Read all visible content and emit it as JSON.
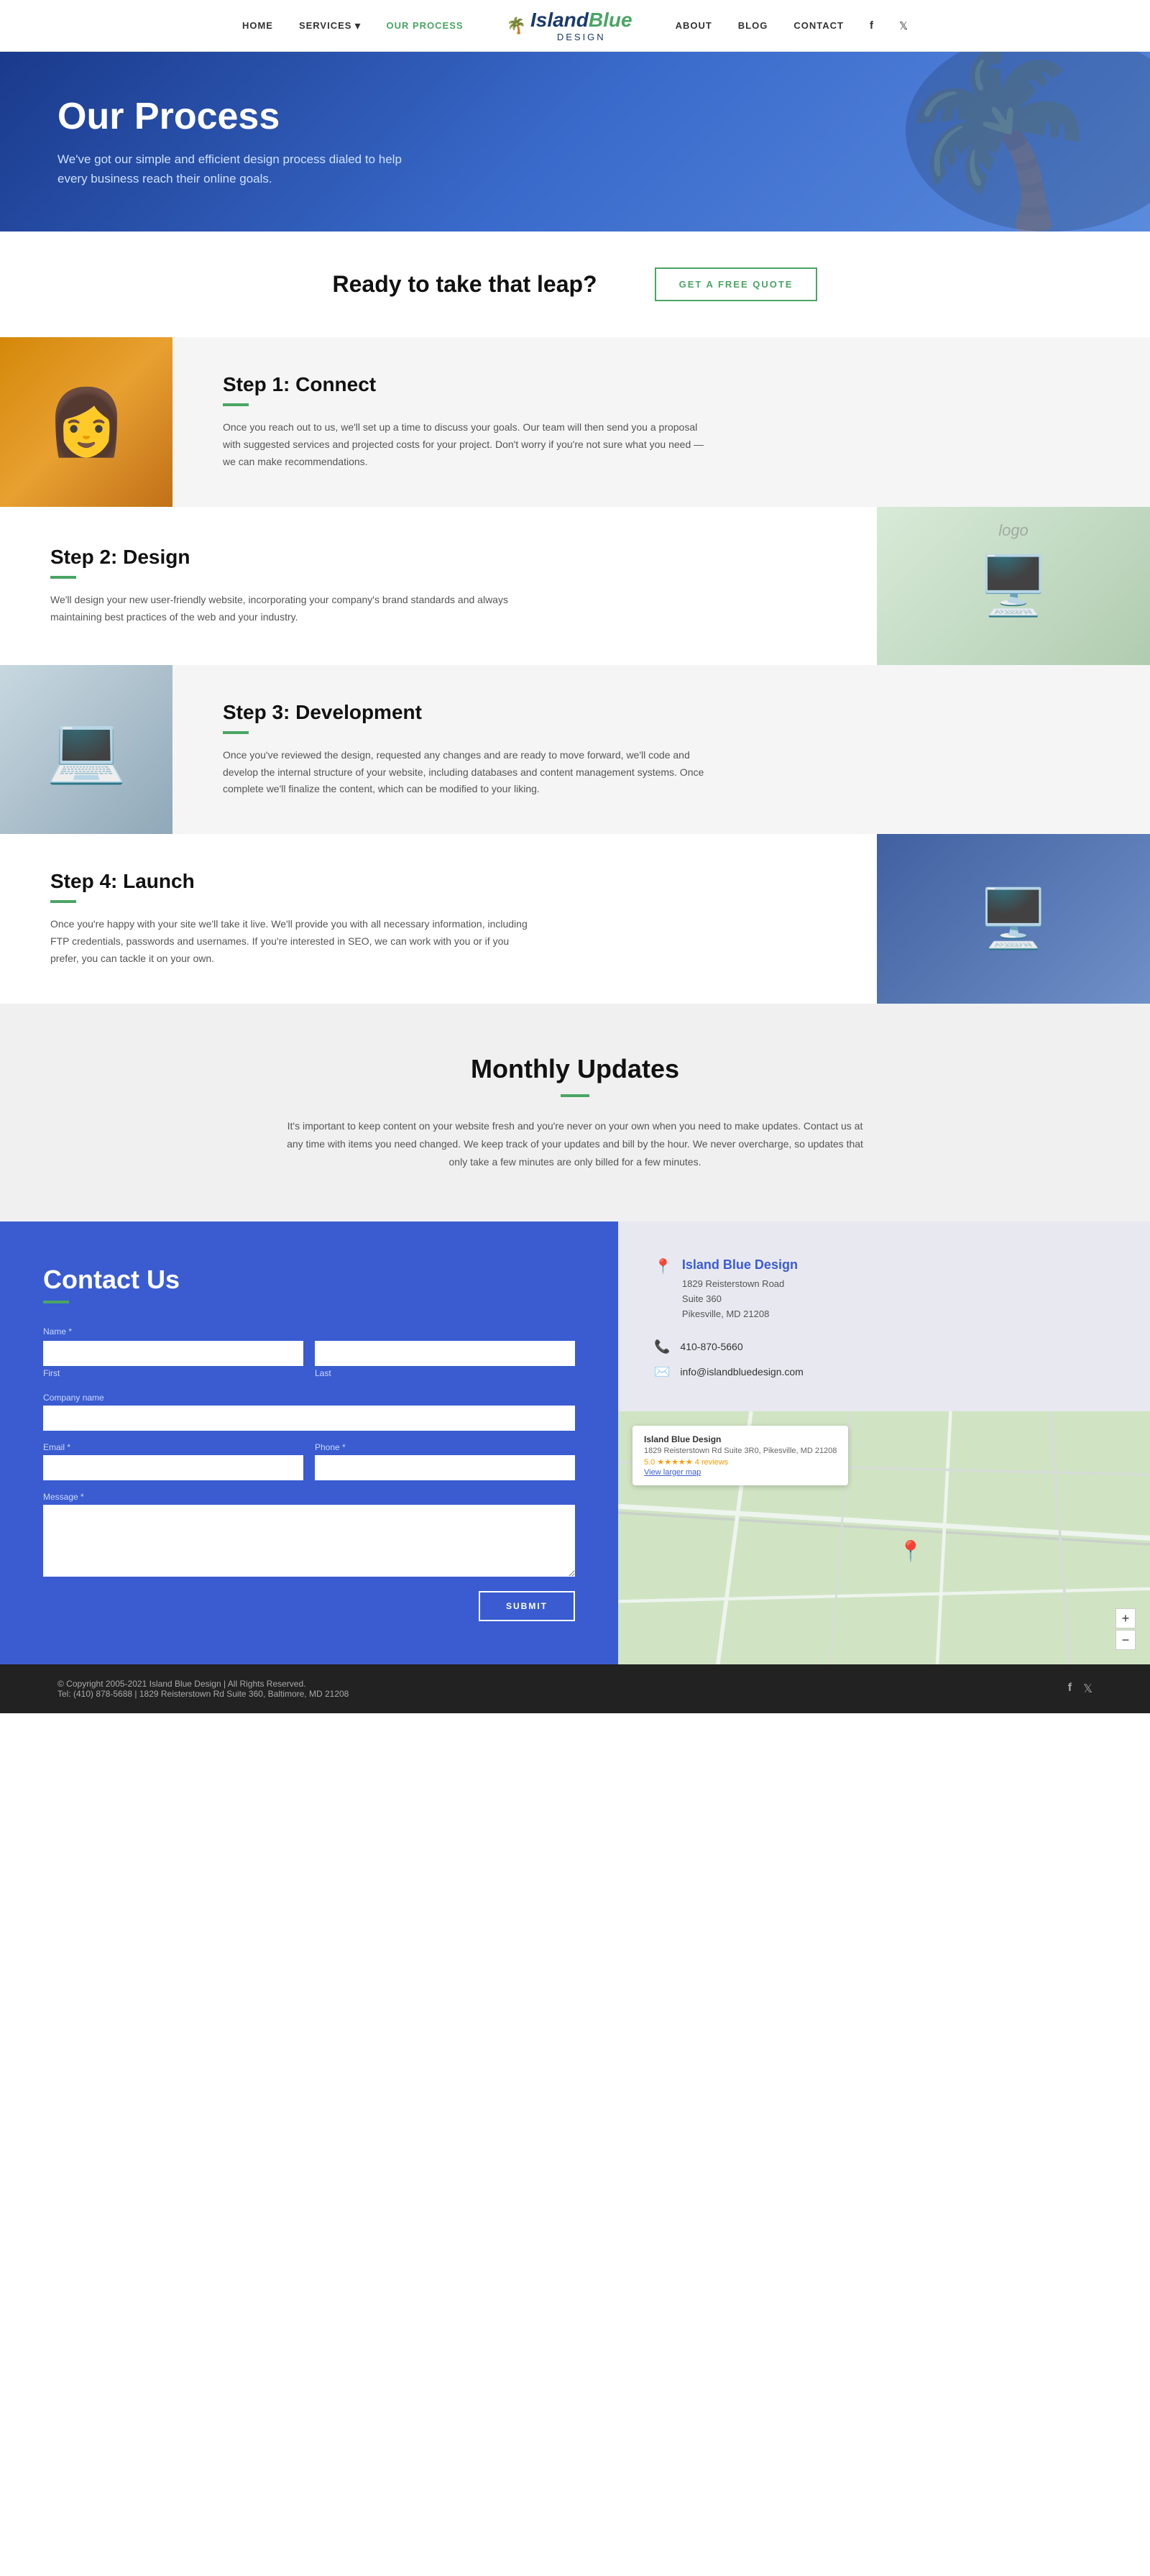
{
  "header": {
    "nav_left": [
      {
        "label": "HOME",
        "href": "#",
        "active": false
      },
      {
        "label": "SERVICES",
        "href": "#",
        "active": false,
        "has_dropdown": true
      },
      {
        "label": "OUR PROCESS",
        "href": "#",
        "active": true
      }
    ],
    "logo": {
      "main": "Island Blue",
      "sub": "design",
      "palm": "🌴"
    },
    "nav_right": [
      {
        "label": "ABOUT",
        "href": "#",
        "active": false
      },
      {
        "label": "BLOG",
        "href": "#",
        "active": false
      },
      {
        "label": "CONTACT",
        "href": "#",
        "active": false
      }
    ],
    "social": [
      {
        "icon": "f",
        "href": "#",
        "name": "facebook"
      },
      {
        "icon": "🐦",
        "href": "#",
        "name": "twitter"
      }
    ]
  },
  "hero": {
    "title": "Our Process",
    "subtitle": "We've got our simple and efficient design process dialed to help every business reach their online goals."
  },
  "cta": {
    "heading": "Ready to take that leap?",
    "button_label": "GET A FREE QUOTE"
  },
  "steps": [
    {
      "number": "1",
      "title": "Step 1: Connect",
      "text": "Once you reach out to us, we'll set up a time to discuss your goals. Our team will then send you a proposal with suggested services and projected costs for your project. Don't worry if you're not sure what you need — we can make recommendations.",
      "image_emoji": "👩",
      "layout": "left"
    },
    {
      "number": "2",
      "title": "Step 2: Design",
      "text": "We'll design your new user-friendly website, incorporating your company's brand standards and always maintaining best practices of the web and your industry.",
      "image_emoji": "🖥️",
      "layout": "right"
    },
    {
      "number": "3",
      "title": "Step 3: Development",
      "text": "Once you've reviewed the design, requested any changes and are ready to move forward, we'll code and develop the internal structure of your website, including databases and content management systems. Once complete we'll finalize the content, which can be modified to your liking.",
      "image_emoji": "💻",
      "layout": "left"
    },
    {
      "number": "4",
      "title": "Step 4: Launch",
      "text": "Once you're happy with your site we'll take it live. We'll provide you with all necessary information, including FTP credentials, passwords and usernames. If you're interested in SEO, we can work with you or if you prefer, you can tackle it on your own.",
      "image_emoji": "🖥️",
      "layout": "right"
    }
  ],
  "monthly": {
    "title": "Monthly Updates",
    "text": "It's important to keep content on your website fresh and you're never on your own when you need to make updates. Contact us at any time with items you need changed. We keep track of your updates and bill by the hour. We never overcharge, so updates that only take a few minutes are only billed for a few minutes."
  },
  "contact_form": {
    "title": "Contact Us",
    "fields": {
      "first_label": "First",
      "last_label": "Last",
      "company_label": "Company name",
      "email_label": "Email *",
      "phone_label": "Phone *",
      "message_label": "Message *",
      "name_label": "Name *"
    },
    "submit_label": "SUBMIT"
  },
  "contact_info": {
    "company_name": "Island Blue Design",
    "address_line1": "1829 Reisterstown Road",
    "address_line2": "Suite 360",
    "address_line3": "Pikesville, MD 21208",
    "phone": "410-870-5660",
    "email": "info@islandbluedesign.com",
    "map_card": {
      "title": "Island Blue Design",
      "address": "1829 Reisterstown Rd Suite 3R0, Pikesville, MD 21208",
      "rating": "5.0 ★★★★★  4 reviews",
      "link": "View larger map"
    }
  },
  "footer": {
    "copyright": "© Copyright 2005-2021 Island Blue Design | All Rights Reserved.",
    "tel": "Tel: (410) 878-5688 | 1829 Reisterstown Rd Suite 360, Baltimore, MD 21208",
    "social_facebook": "f",
    "social_twitter": "🐦"
  }
}
